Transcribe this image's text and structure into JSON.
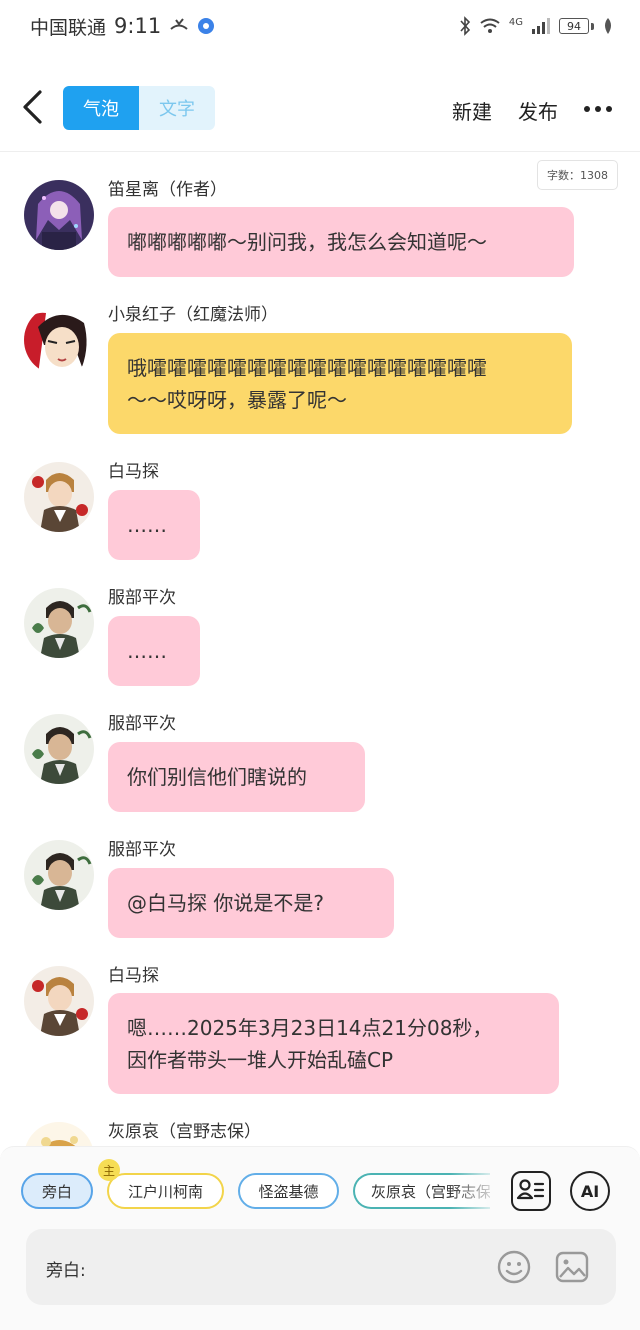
{
  "status_bar": {
    "carrier": "中国联通",
    "time": "9:11",
    "network": "4G",
    "battery": "94"
  },
  "header": {
    "tabs": [
      {
        "label": "气泡",
        "active": true
      },
      {
        "label": "文字",
        "active": false
      }
    ],
    "new_label": "新建",
    "publish_label": "发布"
  },
  "word_count": "字数：1308",
  "messages": [
    {
      "speaker": "笛星离（作者）",
      "lines": [
        "嘟嘟嘟嘟嘟～别问我，我怎么会知道呢～"
      ],
      "bubble_color": "#ffcad8"
    },
    {
      "speaker": "小泉红子（红魔法师）",
      "lines": [
        "哦嚯嚯嚯嚯嚯嚯嚯嚯嚯嚯嚯嚯嚯嚯嚯嚯嚯",
        "～～哎呀呀，暴露了呢～"
      ],
      "bubble_color": "#fcd86a"
    },
    {
      "speaker": "白马探",
      "lines": [
        "……"
      ],
      "bubble_color": "#ffcad8"
    },
    {
      "speaker": "服部平次",
      "lines": [
        "……"
      ],
      "bubble_color": "#ffcad8"
    },
    {
      "speaker": "服部平次",
      "lines": [
        "你们别信他们瞎说的"
      ],
      "bubble_color": "#ffcad8"
    },
    {
      "speaker": "服部平次",
      "lines": [
        "@白马探 你说是不是?"
      ],
      "bubble_color": "#ffcad8"
    },
    {
      "speaker": "白马探",
      "lines": [
        "嗯……2025年3月23日14点21分08秒，",
        "因作者带头一堆人开始乱磕CP"
      ],
      "bubble_color": "#ffcad8"
    },
    {
      "speaker": "灰原哀（宫野志保）",
      "lines": [],
      "bubble_color": "#ffcad8"
    }
  ],
  "roles": [
    {
      "label": "旁白",
      "selected": true
    },
    {
      "label": "江户川柯南",
      "badge": "主"
    },
    {
      "label": "怪盗基德"
    },
    {
      "label": "灰原哀（宫野志保）"
    }
  ],
  "ai_label": "AI",
  "input": {
    "label": "旁白:",
    "placeholder": ""
  }
}
